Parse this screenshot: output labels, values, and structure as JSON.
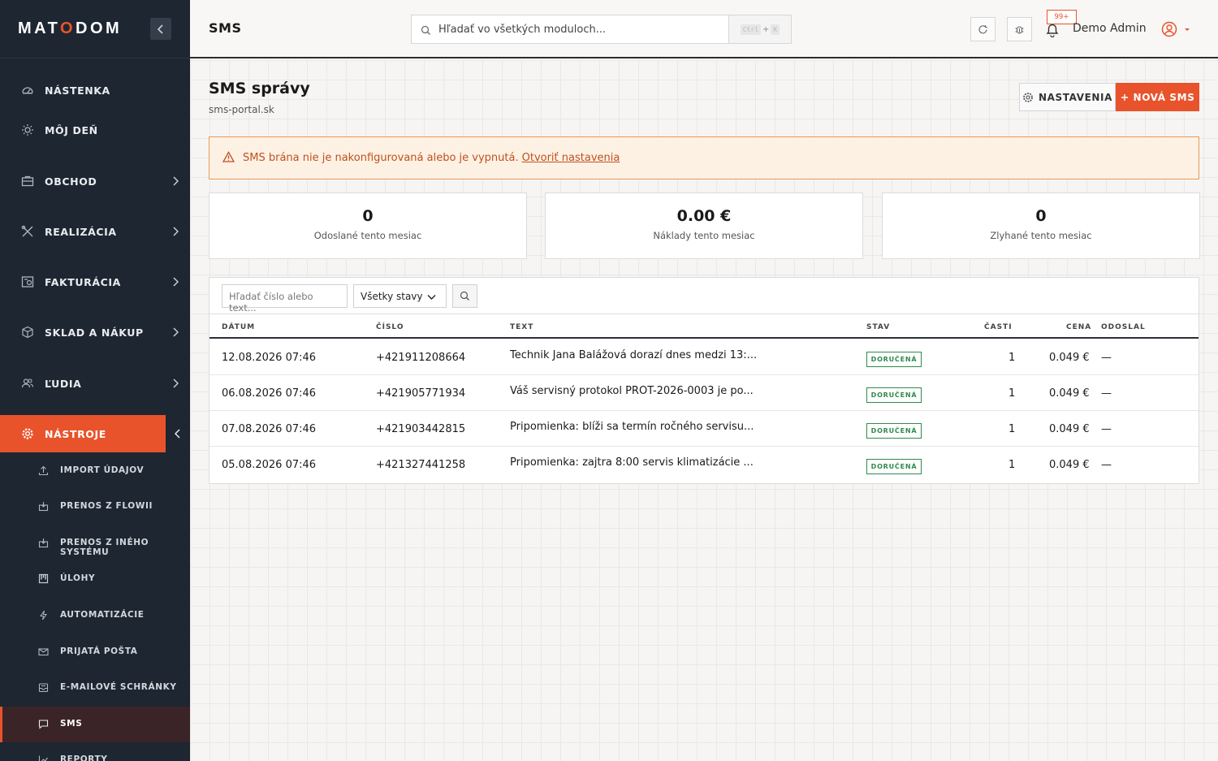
{
  "brand": {
    "logo_pre": "MAT",
    "logo_o": "O",
    "logo_post": "DOM"
  },
  "sidebar": {
    "items": [
      {
        "label": "NÁSTENKA"
      },
      {
        "label": "MÔJ DEŇ"
      },
      {
        "label": "OBCHOD"
      },
      {
        "label": "REALIZÁCIA"
      },
      {
        "label": "FAKTURÁCIA"
      },
      {
        "label": "SKLAD A NÁKUP"
      },
      {
        "label": "ĽUDIA"
      },
      {
        "label": "NÁSTROJE"
      }
    ],
    "sub_items": [
      {
        "label": "IMPORT ÚDAJOV"
      },
      {
        "label": "PRENOS Z FLOWII"
      },
      {
        "label": "PRENOS Z INÉHO SYSTÉMU"
      },
      {
        "label": "ÚLOHY"
      },
      {
        "label": "AUTOMATIZÁCIE"
      },
      {
        "label": "PRIJATÁ POŠTA"
      },
      {
        "label": "E-MAILOVÉ SCHRÁNKY"
      },
      {
        "label": "SMS"
      },
      {
        "label": "REPORTY"
      }
    ]
  },
  "header": {
    "title": "SMS",
    "search_placeholder": "Hľadať vo všetkých moduloch...",
    "kbd_ctrl": "Ctrl",
    "kbd_plus": "+",
    "kbd_k": "K",
    "notif_badge": "99+",
    "user_name": "Demo Admin"
  },
  "page": {
    "title": "SMS správy",
    "subtitle": "sms-portal.sk",
    "settings_label": "NASTAVENIA",
    "new_label": "NOVÁ SMS",
    "alert_text": "SMS brána nie je nakonfigurovaná alebo je vypnutá.",
    "alert_link": "Otvoriť nastavenia"
  },
  "stats": [
    {
      "value": "0",
      "caption": "Odoslané tento mesiac"
    },
    {
      "value": "0.00 €",
      "caption": "Náklady tento mesiac"
    },
    {
      "value": "0",
      "caption": "Zlyhané tento mesiac"
    }
  ],
  "filters": {
    "search_placeholder": "Hľadať číslo alebo text...",
    "status_selected": "Všetky stavy"
  },
  "table": {
    "columns": [
      "DÁTUM",
      "ČÍSLO",
      "TEXT",
      "STAV",
      "ČASTI",
      "CENA",
      "ODOSLAL"
    ],
    "rows": [
      {
        "date": "12.08.2026 07:46",
        "number": "+421911208664",
        "text": "Technik Jana Balážová dorazí dnes medzi 13:...",
        "status": "DORUČENÁ",
        "parts": "1",
        "price": "0.049 €",
        "sender": "—"
      },
      {
        "date": "06.08.2026 07:46",
        "number": "+421905771934",
        "text": "Váš servisný protokol PROT-2026-0003 je po...",
        "status": "DORUČENÁ",
        "parts": "1",
        "price": "0.049 €",
        "sender": "—"
      },
      {
        "date": "07.08.2026 07:46",
        "number": "+421903442815",
        "text": "Pripomienka: blíži sa termín ročného servisu...",
        "status": "DORUČENÁ",
        "parts": "1",
        "price": "0.049 €",
        "sender": "—"
      },
      {
        "date": "05.08.2026 07:46",
        "number": "+421327441258",
        "text": "Pripomienka: zajtra 8:00 servis klimatizácie ...",
        "status": "DORUČENÁ",
        "parts": "1",
        "price": "0.049 €",
        "sender": "—"
      }
    ]
  },
  "colors": {
    "accent": "#e8532b",
    "sidebar_bg": "#1d2631",
    "success": "#2f8a4c",
    "alert_text": "#c0501e"
  }
}
